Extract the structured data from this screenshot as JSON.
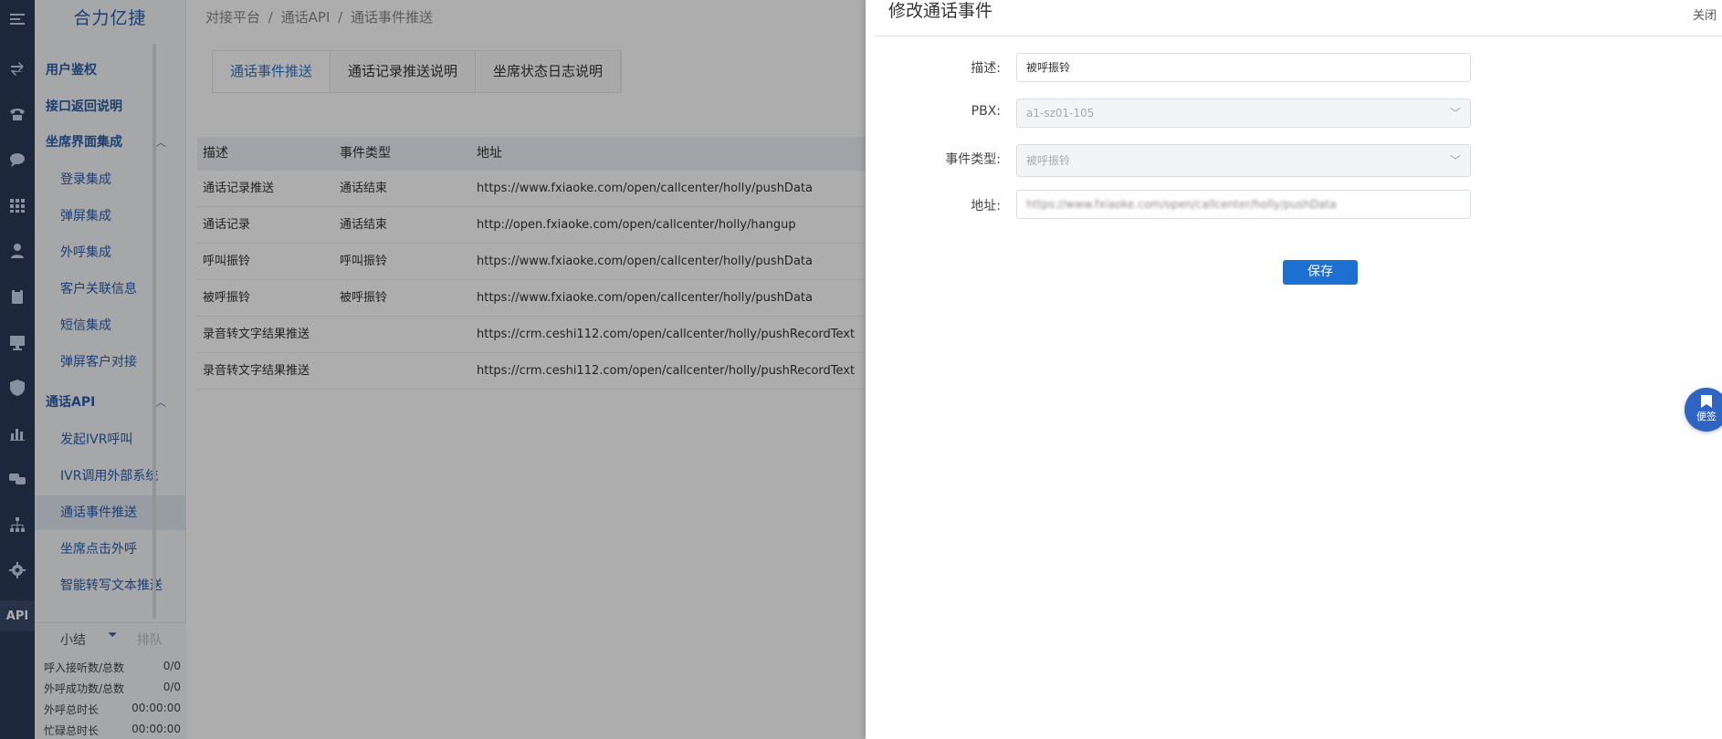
{
  "brand": "合力亿捷",
  "rail": {
    "api_label": "API"
  },
  "sidebar": {
    "menu": [
      {
        "label": "用户鉴权"
      },
      {
        "label": "接口返回说明"
      },
      {
        "label": "坐席界面集成",
        "children": [
          "登录集成",
          "弹屏集成",
          "外呼集成",
          "客户关联信息",
          "短信集成",
          "弹屏客户对接"
        ]
      },
      {
        "label": "通话API",
        "children": [
          "发起IVR呼叫",
          "IVR调用外部系统",
          "通话事件推送",
          "坐席点击外呼",
          "智能转写文本推送"
        ]
      }
    ],
    "active_item": "通话事件推送"
  },
  "stats": {
    "tab_summary": "小结",
    "tab_queue": "排队",
    "rows": [
      {
        "label": "呼入接听数/总数",
        "value": "0/0"
      },
      {
        "label": "外呼成功数/总数",
        "value": "0/0"
      },
      {
        "label": "外呼总时长",
        "value": "00:00:00"
      },
      {
        "label": "忙碌总时长",
        "value": "00:00:00"
      }
    ]
  },
  "breadcrumb": [
    "对接平台",
    "/",
    "通话API",
    "/",
    "通话事件推送"
  ],
  "tabs": [
    "通话事件推送",
    "通话记录推送说明",
    "坐席状态日志说明"
  ],
  "table": {
    "headers": [
      "描述",
      "事件类型",
      "地址"
    ],
    "rows": [
      [
        "通话记录推送",
        "通话结束",
        "https://www.fxiaoke.com/open/callcenter/holly/pushData"
      ],
      [
        "通话记录",
        "通话结束",
        "http://open.fxiaoke.com/open/callcenter/holly/hangup"
      ],
      [
        "呼叫振铃",
        "呼叫振铃",
        "https://www.fxiaoke.com/open/callcenter/holly/pushData"
      ],
      [
        "被呼振铃",
        "被呼振铃",
        "https://www.fxiaoke.com/open/callcenter/holly/pushData"
      ],
      [
        "录音转文字结果推送",
        "",
        "https://crm.ceshi112.com/open/callcenter/holly/pushRecordText"
      ],
      [
        "录音转文字结果推送",
        "",
        "https://crm.ceshi112.com/open/callcenter/holly/pushRecordText"
      ]
    ]
  },
  "drawer": {
    "title": "修改通话事件",
    "close": "关闭",
    "fields": {
      "desc_label": "描述:",
      "desc_value": "被呼振铃",
      "pbx_label": "PBX:",
      "pbx_value": "a1-sz01-105",
      "type_label": "事件类型:",
      "type_value": "被呼振铃",
      "addr_label": "地址:",
      "addr_value": "https://www.fxiaoke.com/open/callcenter/holly/pushData"
    },
    "save": "保存"
  },
  "note_button": "便签",
  "colors": {
    "rail": "#2b3a58",
    "accent": "#2b75c7",
    "save": "#1d6fd1"
  }
}
